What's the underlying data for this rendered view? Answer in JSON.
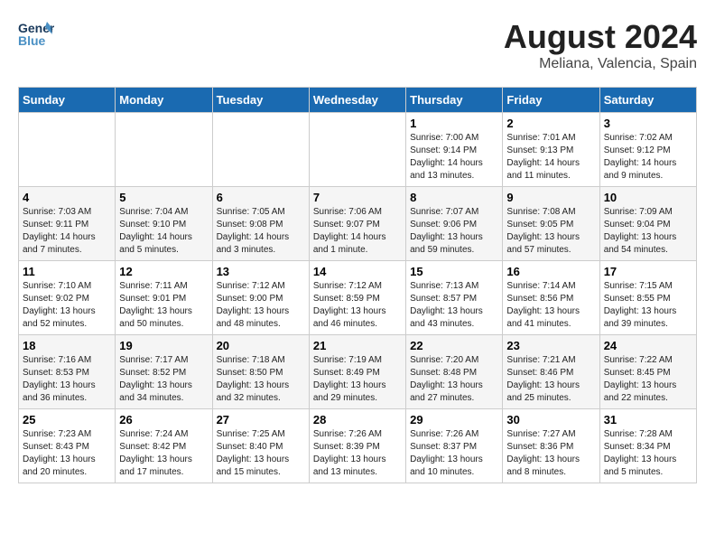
{
  "logo": {
    "line1": "General",
    "line2": "Blue"
  },
  "title": "August 2024",
  "subtitle": "Meliana, Valencia, Spain",
  "days_of_week": [
    "Sunday",
    "Monday",
    "Tuesday",
    "Wednesday",
    "Thursday",
    "Friday",
    "Saturday"
  ],
  "weeks": [
    [
      {
        "day": "",
        "info": ""
      },
      {
        "day": "",
        "info": ""
      },
      {
        "day": "",
        "info": ""
      },
      {
        "day": "",
        "info": ""
      },
      {
        "day": "1",
        "info": "Sunrise: 7:00 AM\nSunset: 9:14 PM\nDaylight: 14 hours\nand 13 minutes."
      },
      {
        "day": "2",
        "info": "Sunrise: 7:01 AM\nSunset: 9:13 PM\nDaylight: 14 hours\nand 11 minutes."
      },
      {
        "day": "3",
        "info": "Sunrise: 7:02 AM\nSunset: 9:12 PM\nDaylight: 14 hours\nand 9 minutes."
      }
    ],
    [
      {
        "day": "4",
        "info": "Sunrise: 7:03 AM\nSunset: 9:11 PM\nDaylight: 14 hours\nand 7 minutes."
      },
      {
        "day": "5",
        "info": "Sunrise: 7:04 AM\nSunset: 9:10 PM\nDaylight: 14 hours\nand 5 minutes."
      },
      {
        "day": "6",
        "info": "Sunrise: 7:05 AM\nSunset: 9:08 PM\nDaylight: 14 hours\nand 3 minutes."
      },
      {
        "day": "7",
        "info": "Sunrise: 7:06 AM\nSunset: 9:07 PM\nDaylight: 14 hours\nand 1 minute."
      },
      {
        "day": "8",
        "info": "Sunrise: 7:07 AM\nSunset: 9:06 PM\nDaylight: 13 hours\nand 59 minutes."
      },
      {
        "day": "9",
        "info": "Sunrise: 7:08 AM\nSunset: 9:05 PM\nDaylight: 13 hours\nand 57 minutes."
      },
      {
        "day": "10",
        "info": "Sunrise: 7:09 AM\nSunset: 9:04 PM\nDaylight: 13 hours\nand 54 minutes."
      }
    ],
    [
      {
        "day": "11",
        "info": "Sunrise: 7:10 AM\nSunset: 9:02 PM\nDaylight: 13 hours\nand 52 minutes."
      },
      {
        "day": "12",
        "info": "Sunrise: 7:11 AM\nSunset: 9:01 PM\nDaylight: 13 hours\nand 50 minutes."
      },
      {
        "day": "13",
        "info": "Sunrise: 7:12 AM\nSunset: 9:00 PM\nDaylight: 13 hours\nand 48 minutes."
      },
      {
        "day": "14",
        "info": "Sunrise: 7:12 AM\nSunset: 8:59 PM\nDaylight: 13 hours\nand 46 minutes."
      },
      {
        "day": "15",
        "info": "Sunrise: 7:13 AM\nSunset: 8:57 PM\nDaylight: 13 hours\nand 43 minutes."
      },
      {
        "day": "16",
        "info": "Sunrise: 7:14 AM\nSunset: 8:56 PM\nDaylight: 13 hours\nand 41 minutes."
      },
      {
        "day": "17",
        "info": "Sunrise: 7:15 AM\nSunset: 8:55 PM\nDaylight: 13 hours\nand 39 minutes."
      }
    ],
    [
      {
        "day": "18",
        "info": "Sunrise: 7:16 AM\nSunset: 8:53 PM\nDaylight: 13 hours\nand 36 minutes."
      },
      {
        "day": "19",
        "info": "Sunrise: 7:17 AM\nSunset: 8:52 PM\nDaylight: 13 hours\nand 34 minutes."
      },
      {
        "day": "20",
        "info": "Sunrise: 7:18 AM\nSunset: 8:50 PM\nDaylight: 13 hours\nand 32 minutes."
      },
      {
        "day": "21",
        "info": "Sunrise: 7:19 AM\nSunset: 8:49 PM\nDaylight: 13 hours\nand 29 minutes."
      },
      {
        "day": "22",
        "info": "Sunrise: 7:20 AM\nSunset: 8:48 PM\nDaylight: 13 hours\nand 27 minutes."
      },
      {
        "day": "23",
        "info": "Sunrise: 7:21 AM\nSunset: 8:46 PM\nDaylight: 13 hours\nand 25 minutes."
      },
      {
        "day": "24",
        "info": "Sunrise: 7:22 AM\nSunset: 8:45 PM\nDaylight: 13 hours\nand 22 minutes."
      }
    ],
    [
      {
        "day": "25",
        "info": "Sunrise: 7:23 AM\nSunset: 8:43 PM\nDaylight: 13 hours\nand 20 minutes."
      },
      {
        "day": "26",
        "info": "Sunrise: 7:24 AM\nSunset: 8:42 PM\nDaylight: 13 hours\nand 17 minutes."
      },
      {
        "day": "27",
        "info": "Sunrise: 7:25 AM\nSunset: 8:40 PM\nDaylight: 13 hours\nand 15 minutes."
      },
      {
        "day": "28",
        "info": "Sunrise: 7:26 AM\nSunset: 8:39 PM\nDaylight: 13 hours\nand 13 minutes."
      },
      {
        "day": "29",
        "info": "Sunrise: 7:26 AM\nSunset: 8:37 PM\nDaylight: 13 hours\nand 10 minutes."
      },
      {
        "day": "30",
        "info": "Sunrise: 7:27 AM\nSunset: 8:36 PM\nDaylight: 13 hours\nand 8 minutes."
      },
      {
        "day": "31",
        "info": "Sunrise: 7:28 AM\nSunset: 8:34 PM\nDaylight: 13 hours\nand 5 minutes."
      }
    ]
  ]
}
